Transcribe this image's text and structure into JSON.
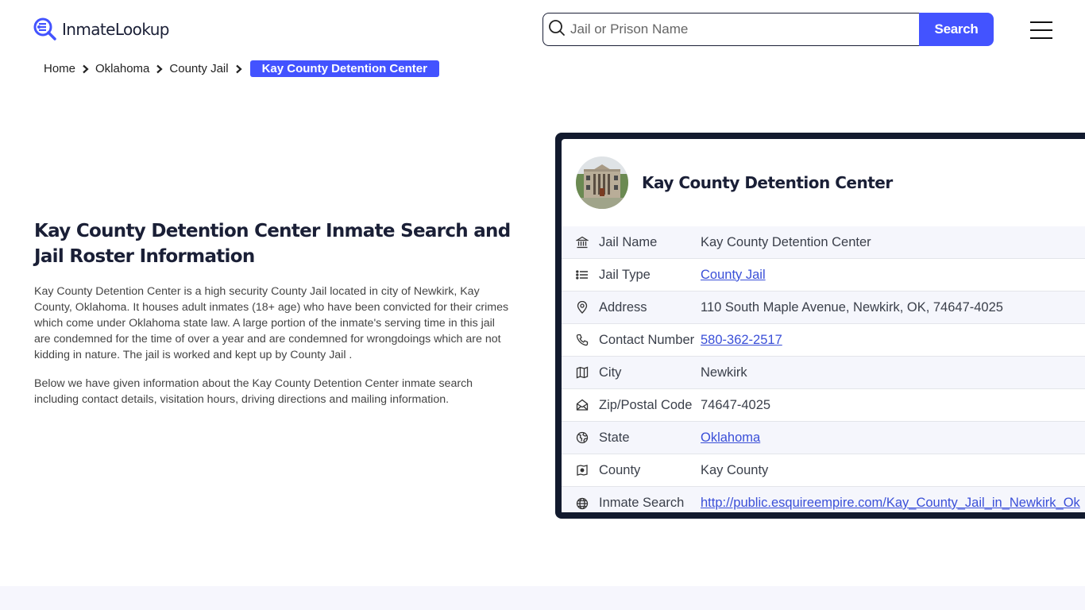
{
  "header": {
    "logo_text": "InmateLookup",
    "search_placeholder": "Jail or Prison Name",
    "search_button": "Search"
  },
  "breadcrumb": [
    {
      "label": "Home"
    },
    {
      "label": "Oklahoma"
    },
    {
      "label": "County Jail"
    },
    {
      "label": "Kay County Detention Center",
      "active": true
    }
  ],
  "intro": {
    "title": "Kay County Detention Center Inmate Search and Jail Roster Information",
    "paragraphs": [
      "Kay County Detention Center is a high security County Jail located in city of Newkirk, Kay County, Oklahoma. It houses adult inmates (18+ age) who have been convicted for their crimes which come under Oklahoma state law. A large portion of the inmate's serving time in this jail are condemned for the time of over a year and are condemned for wrongdoings which are not kidding in nature. The jail is worked and kept up by County Jail .",
      "Below we have given information about the Kay County Detention Center inmate search including contact details, visitation hours, driving directions and mailing information."
    ]
  },
  "card": {
    "title": "Kay County Detention Center",
    "rows": [
      {
        "icon": "bank-icon",
        "label": "Jail Name",
        "value": "Kay County Detention Center",
        "link": false
      },
      {
        "icon": "list-icon",
        "label": "Jail Type",
        "value": "County Jail",
        "link": true
      },
      {
        "icon": "map-pin-icon",
        "label": "Address",
        "value": "110 South Maple Avenue, Newkirk, OK, 74647-4025",
        "link": false
      },
      {
        "icon": "phone-icon",
        "label": "Contact Number",
        "value": "580-362-2517",
        "link": true
      },
      {
        "icon": "map-icon",
        "label": "City",
        "value": "Newkirk",
        "link": false
      },
      {
        "icon": "mail-open-icon",
        "label": "Zip/Postal Code",
        "value": "74647-4025",
        "link": false
      },
      {
        "icon": "globe-region-icon",
        "label": "State",
        "value": "Oklahoma",
        "link": true
      },
      {
        "icon": "county-map-icon",
        "label": "County",
        "value": "Kay County",
        "link": false
      },
      {
        "icon": "globe-icon",
        "label": "Inmate Search",
        "value": "http://public.esquireempire.com/Kay_County_Jail_in_Newkirk_Ok",
        "link": true
      }
    ]
  },
  "colors": {
    "accent": "#4353ff",
    "card_border": "#121a2e",
    "link": "#3a4fd8",
    "row_alt": "#f5f6fc"
  }
}
